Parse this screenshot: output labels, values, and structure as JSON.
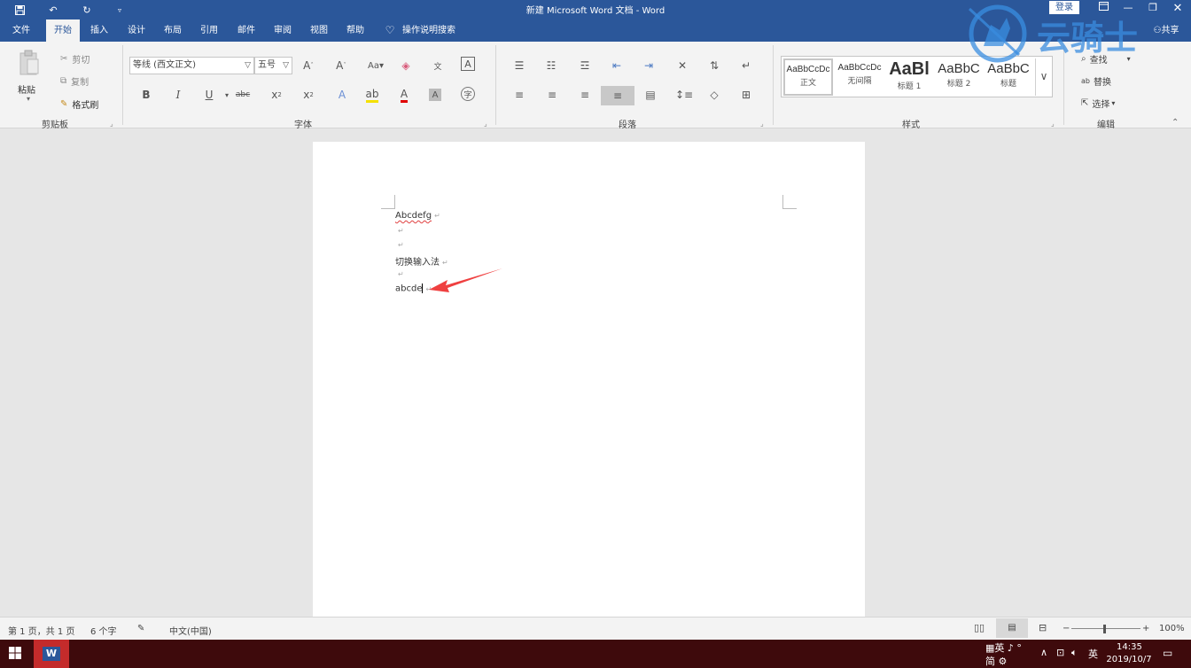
{
  "window": {
    "title": "新建 Microsoft Word 文档  -  Word",
    "login": "登录",
    "share": "共享"
  },
  "tabs": [
    "文件",
    "开始",
    "插入",
    "设计",
    "布局",
    "引用",
    "邮件",
    "审阅",
    "视图",
    "帮助"
  ],
  "search_tell": "操作说明搜索",
  "clipboard": {
    "paste": "粘贴",
    "cut": "剪切",
    "copy": "复制",
    "format_painter": "格式刷",
    "group": "剪贴板"
  },
  "font": {
    "name": "等线 (西文正文)",
    "size": "五号",
    "group": "字体"
  },
  "paragraph": {
    "group": "段落"
  },
  "styles": {
    "items": [
      {
        "preview": "AaBbCcDc",
        "name": "正文"
      },
      {
        "preview": "AaBbCcDc",
        "name": "无间隔"
      },
      {
        "preview": "AaBl",
        "name": "标题 1"
      },
      {
        "preview": "AaBbC",
        "name": "标题 2"
      },
      {
        "preview": "AaBbC",
        "name": "标题"
      }
    ],
    "group": "样式"
  },
  "editing": {
    "find": "查找",
    "replace": "替换",
    "select": "选择",
    "group": "编辑"
  },
  "document": {
    "lines": [
      "Abcdefg",
      "",
      "",
      "切换输入法",
      "",
      "abcde"
    ]
  },
  "status": {
    "page": "第 1 页，共 1 页",
    "words": "6 个字",
    "language": "中文(中国)",
    "zoom": "100%"
  },
  "taskbar": {
    "ime_top": "英",
    "ime_bottom": "简",
    "lang": "英",
    "time": "14:35",
    "date": "2019/10/7"
  },
  "watermark": {
    "text": "云骑士"
  }
}
